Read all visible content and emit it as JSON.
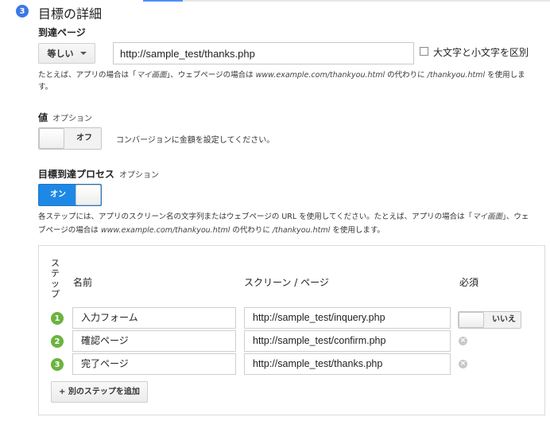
{
  "section": {
    "number": "3",
    "title": "目標の詳細"
  },
  "destination": {
    "label": "到達ページ",
    "match_type": "等しい",
    "url_value": "http://sample_test/thanks.php",
    "case_sensitive_label": "大文字と小文字を区別",
    "case_sensitive_checked": false,
    "hint_part1": "たとえば、アプリの場合は「",
    "hint_app_example": "マイ画面",
    "hint_part2": "」、ウェブページの場合は ",
    "hint_web_example": "www.example.com/thankyou.html",
    "hint_part3": " の代わりに ",
    "hint_path_example": "/thankyou.html",
    "hint_part4": " を使用しま",
    "hint_part5": "す。"
  },
  "value": {
    "label": "値",
    "optional": "オプション",
    "toggle_state": "オフ",
    "description": "コンバージョンに金額を設定してください。"
  },
  "funnel": {
    "label": "目標到達プロセス",
    "optional": "オプション",
    "toggle_state": "オン",
    "desc1_part1": "各ステップには、アプリのスクリーン名の文字列またはウェブページの URL を使用してください。たとえば、アプリの場合は「",
    "desc1_app_example": "マイ画面",
    "desc1_part2": "」、ウェ",
    "desc2_part1": "ブページの場合は ",
    "desc2_web_example": "www.example.com/thankyou.html",
    "desc2_part2": " の代わりに ",
    "desc2_path_example": "/thankyou.html",
    "desc2_part3": " を使用します。",
    "headers": {
      "step": "ステップ",
      "name": "名前",
      "screen": "スクリーン / ページ",
      "required": "必須"
    },
    "steps": [
      {
        "num": "1",
        "name": "入力フォーム",
        "url": "http://sample_test/inquery.php"
      },
      {
        "num": "2",
        "name": "確認ページ",
        "url": "http://sample_test/confirm.php"
      },
      {
        "num": "3",
        "name": "完了ページ",
        "url": "http://sample_test/thanks.php"
      }
    ],
    "required_toggle": "いいえ",
    "add_step": "+ 別のステップを追加",
    "remove_glyph": "×"
  },
  "colors": {
    "accent": "#3b78e7",
    "toggle_on": "#1e88e5",
    "step_number": "#6cb33f"
  }
}
